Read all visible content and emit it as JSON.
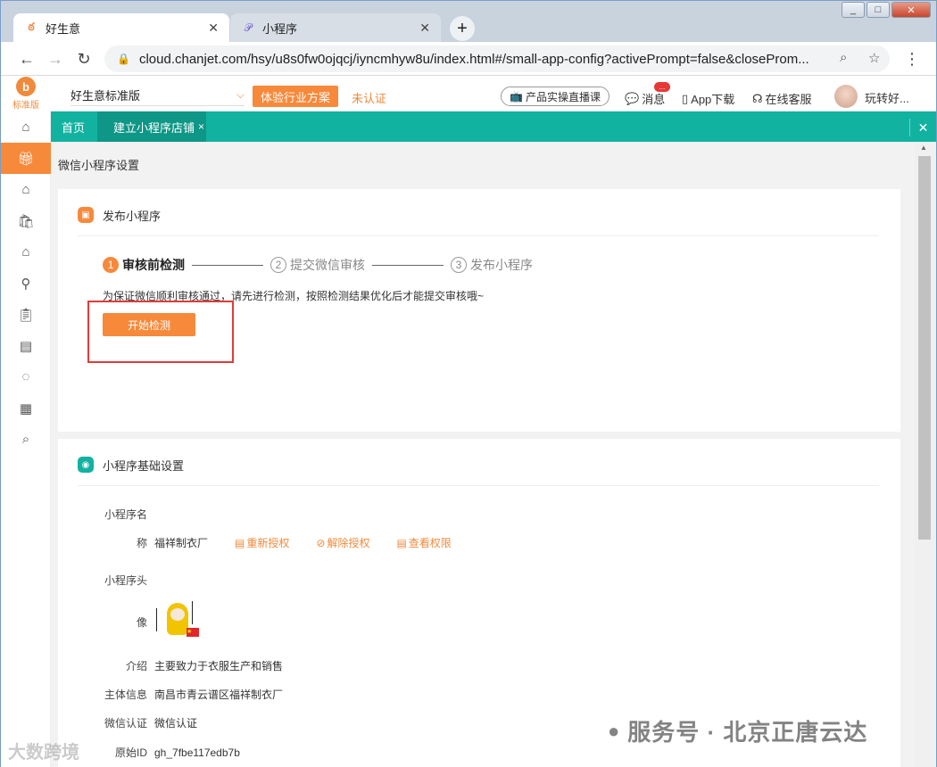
{
  "browser": {
    "tabs": [
      {
        "title": "好生意",
        "icon": "app-logo-icon"
      },
      {
        "title": "小程序",
        "icon": "link-icon"
      }
    ],
    "url": "cloud.chanjet.com/hsy/u8s0fw0ojqcj/iyncmhyw8u/index.html#/small-app-config?activePrompt=false&closeProm..."
  },
  "header": {
    "logo_edition": "标准版",
    "edition_select": "好生意标准版",
    "trial_button": "体验行业方案",
    "unverified": "未认证",
    "live_course": "产品实操直播课",
    "messages": "消息",
    "message_badge": "...",
    "app_download": "App下载",
    "online_service": "在线客服",
    "username": "玩转好..."
  },
  "sidebar": {
    "icons": [
      "home-icon",
      "gift-icon",
      "storefront-icon",
      "shopping-bag-icon",
      "shop-icon",
      "money-bag-icon",
      "clipboard-icon",
      "report-icon",
      "cycle-icon",
      "calendar-icon",
      "search-chat-icon"
    ],
    "active_index": 1
  },
  "page_tabs": {
    "home": "首页",
    "current": "建立小程序店铺"
  },
  "page": {
    "title": "微信小程序设置",
    "publish": {
      "header": "发布小程序",
      "steps": [
        {
          "num": "1",
          "label": "审核前检测"
        },
        {
          "num": "2",
          "label": "提交微信审核"
        },
        {
          "num": "3",
          "label": "发布小程序"
        }
      ],
      "hint": "为保证微信顺利审核通过，请先进行检测，按照检测结果优化后才能提交审核哦~",
      "start_button": "开始检测"
    },
    "basic": {
      "header": "小程序基础设置",
      "name_label_1": "小程序名",
      "name_label_2": "称",
      "name_value": "福祥制衣厂",
      "reauth": "重新授权",
      "unbind": "解除授权",
      "view_perm": "查看权限",
      "avatar_label_1": "小程序头",
      "avatar_label_2": "像",
      "intro_label": "介绍",
      "intro_value": "主要致力于衣服生产和销售",
      "entity_label": "主体信息",
      "entity_value": "南昌市青云谱区福祥制衣厂",
      "wx_cert_label": "微信认证",
      "wx_cert_value": "微信认证",
      "origin_id_label": "原始ID",
      "origin_id_value": "gh_7fbe117edb7b"
    }
  },
  "watermarks": {
    "right": "服务号 · 北京正唐云达",
    "left": "大数跨境"
  }
}
